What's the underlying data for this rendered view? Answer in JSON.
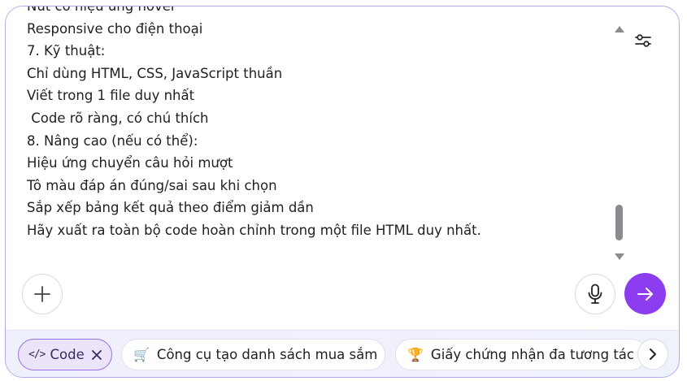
{
  "editor": {
    "lines": [
      "Nút có hiệu ứng hover",
      "Responsive cho điện thoại",
      "7. Kỹ thuật:",
      "Chỉ dùng HTML, CSS, JavaScript thuần",
      "Viết trong 1 file duy nhất",
      " Code rõ ràng, có chú thích",
      "8. Nâng cao (nếu có thể):",
      "Hiệu ứng chuyển câu hỏi mượt",
      "Tô màu đáp án đúng/sai sau khi chọn",
      "Sắp xếp bảng kết quả theo điểm giảm dần",
      "Hãy xuất ra toàn bộ code hoàn chỉnh trong một file HTML duy nhất."
    ]
  },
  "toolbar": {
    "add_icon": "plus-icon",
    "mic_icon": "microphone-icon",
    "send_icon": "arrow-right-icon",
    "settings_icon": "sliders-icon"
  },
  "suggestions": {
    "active_chip": {
      "icon": "</>",
      "label": "Code"
    },
    "chips": [
      {
        "emoji": "🛒",
        "label": "Công cụ tạo danh sách mua sắm"
      },
      {
        "emoji": "🏆",
        "label": "Giấy chứng nhận đa tương tác"
      }
    ]
  },
  "colors": {
    "accent": "#8d3df0",
    "border": "#b9a6ec",
    "chip_active_bg": "#ece4fb"
  }
}
